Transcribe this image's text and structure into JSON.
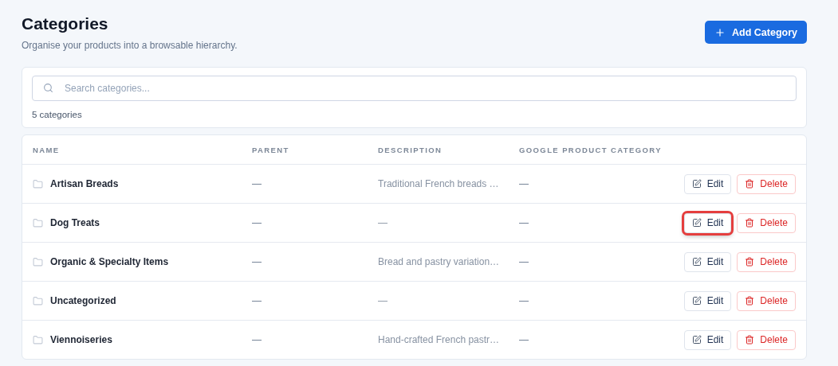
{
  "header": {
    "title": "Categories",
    "subtitle": "Organise your products into a browsable hierarchy.",
    "add_button": "Add Category"
  },
  "search": {
    "placeholder": "Search categories...",
    "count": "5 categories"
  },
  "table": {
    "columns": [
      "NAME",
      "PARENT",
      "DESCRIPTION",
      "GOOGLE PRODUCT CATEGORY"
    ],
    "rows": [
      {
        "name": "Artisan Breads",
        "parent": "—",
        "description": "Traditional French breads …",
        "google": "—",
        "edit": "Edit",
        "delete": "Delete",
        "highlighted": false
      },
      {
        "name": "Dog Treats",
        "parent": "—",
        "description": "—",
        "google": "—",
        "edit": "Edit",
        "delete": "Delete",
        "highlighted": true
      },
      {
        "name": "Organic & Specialty Items",
        "parent": "—",
        "description": "Bread and pastry variation…",
        "google": "—",
        "edit": "Edit",
        "delete": "Delete",
        "highlighted": false
      },
      {
        "name": "Uncategorized",
        "parent": "—",
        "description": "—",
        "google": "—",
        "edit": "Edit",
        "delete": "Delete",
        "highlighted": false
      },
      {
        "name": "Viennoiseries",
        "parent": "—",
        "description": "Hand-crafted French pastr…",
        "google": "—",
        "edit": "Edit",
        "delete": "Delete",
        "highlighted": false
      }
    ]
  }
}
